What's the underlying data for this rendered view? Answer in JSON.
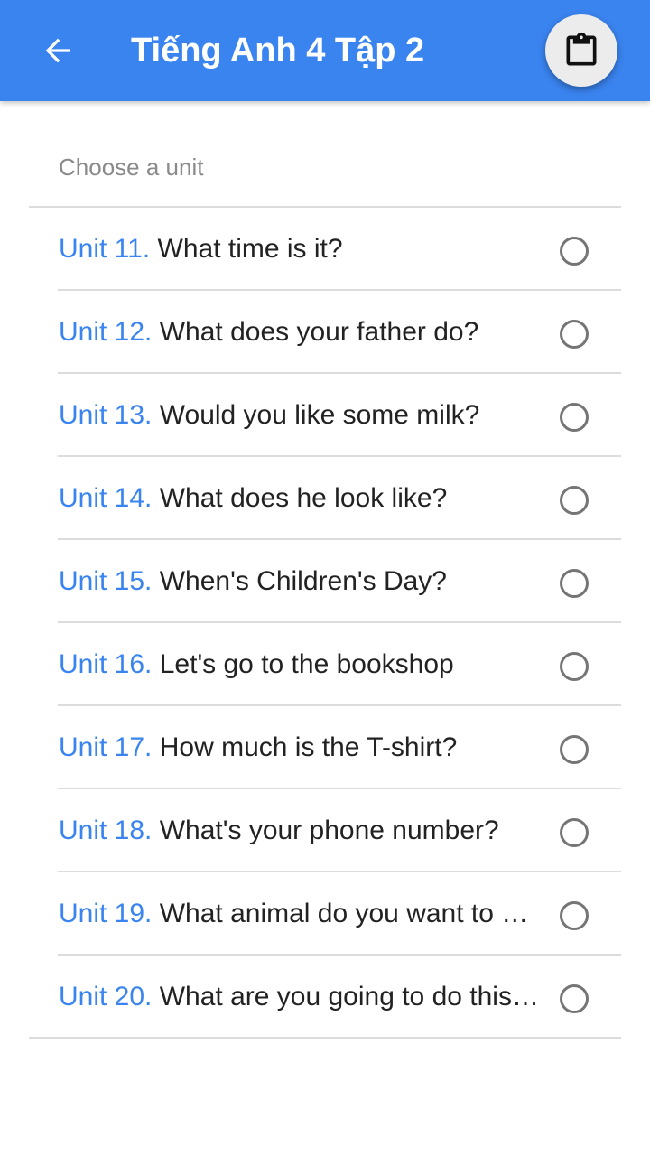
{
  "appbar": {
    "title": "Tiếng Anh 4 Tập 2",
    "back_icon": "arrow-left-icon",
    "action_icon": "clipboard-icon",
    "color": "#3a84f0"
  },
  "prompt": "Choose a unit",
  "units": [
    {
      "num": "Unit 11.",
      "title": "What time is it?",
      "selected": false
    },
    {
      "num": "Unit 12.",
      "title": "What does your father do?",
      "selected": false
    },
    {
      "num": "Unit 13.",
      "title": "Would you like some milk?",
      "selected": false
    },
    {
      "num": "Unit 14.",
      "title": "What does he look like?",
      "selected": false
    },
    {
      "num": "Unit 15.",
      "title": "When's Children's Day?",
      "selected": false
    },
    {
      "num": "Unit 16.",
      "title": "Let's go to the bookshop",
      "selected": false
    },
    {
      "num": "Unit 17.",
      "title": "How much is the T-shirt?",
      "selected": false
    },
    {
      "num": "Unit 18.",
      "title": "What's your phone number?",
      "selected": false
    },
    {
      "num": "Unit 19.",
      "title": "What animal do you want to see?",
      "selected": false
    },
    {
      "num": "Unit 20.",
      "title": "What are you going to do this summer?",
      "selected": false
    }
  ]
}
